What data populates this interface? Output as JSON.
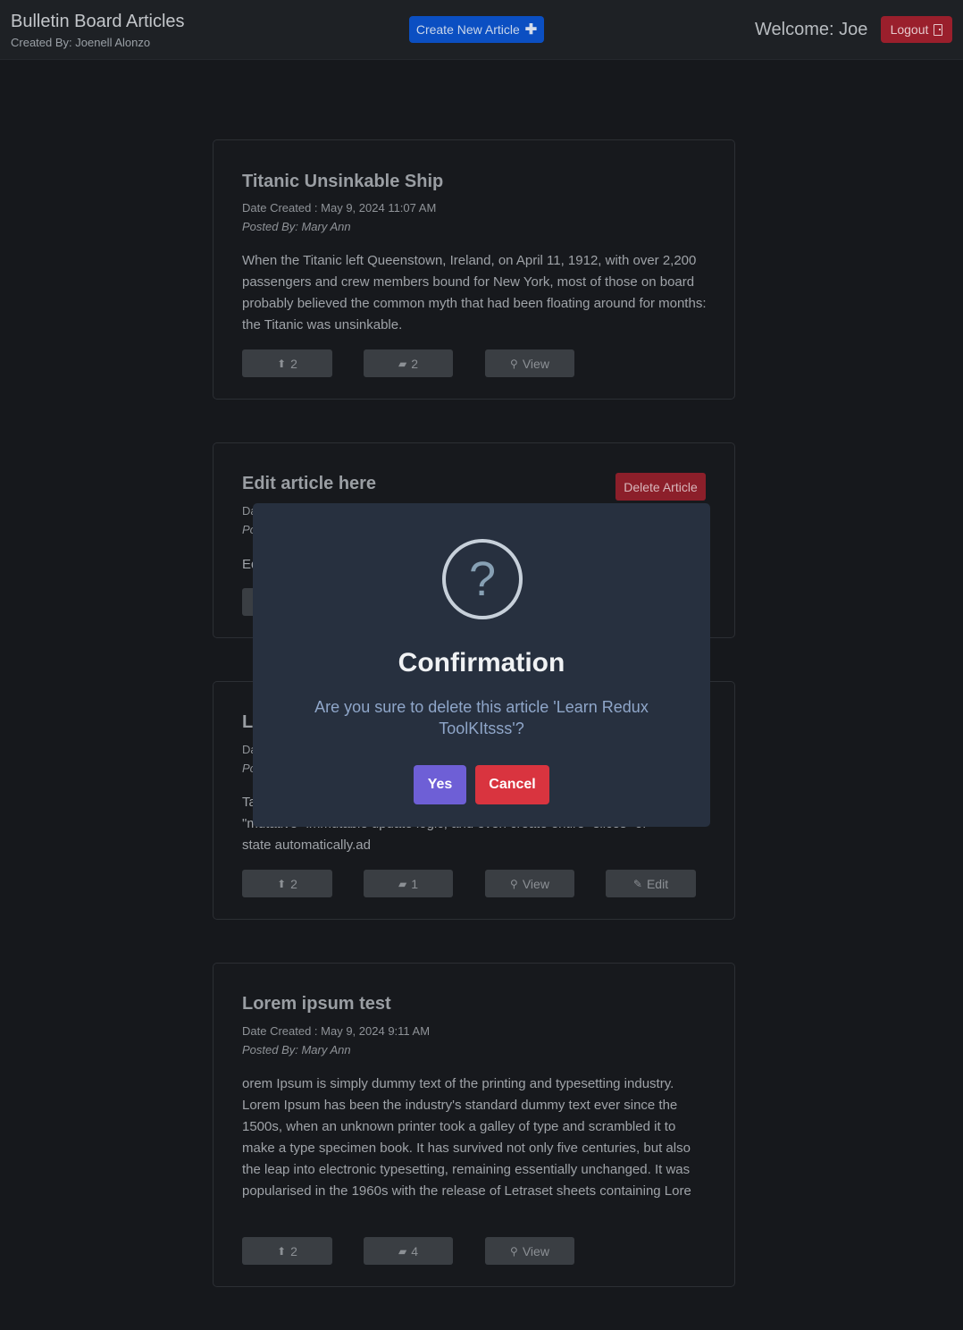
{
  "header": {
    "title": "Bulletin Board Articles",
    "subtitle": "Created By: Joenell Alonzo",
    "create_label": "Create New Article",
    "create_icon": "plus-icon",
    "welcome": "Welcome: Joe",
    "logout_label": "Logout",
    "logout_icon": "door-icon"
  },
  "articles": [
    {
      "title": "Titanic Unsinkable Ship",
      "date": "Date Created : May 9, 2024 11:07 AM",
      "posted": "Posted By: Mary Ann",
      "body": "When the Titanic left Queenstown, Ireland, on April 11, 1912, with over 2,200 passengers and crew members bound for New York, most of those on board probably believed the common myth that had been floating around for months: the Titanic was unsinkable.",
      "upvotes": "2",
      "comments": "2",
      "view_label": "View"
    },
    {
      "title": "Edit article here",
      "date_prefix": "Da",
      "posted_prefix": "Po",
      "body_prefix": "Ed",
      "delete_label": "Delete Article"
    },
    {
      "title_prefix": "Le",
      "date_prefix": "Da",
      "posted_prefix": "Po",
      "body_line1_prefix": "Ta",
      "body_line2": "\"mutative\" immutable update logic, and even create entire \"slices\" of",
      "body_line3": "state automatically.ad",
      "upvotes": "2",
      "comments": "1",
      "view_label": "View",
      "edit_label": "Edit"
    },
    {
      "title": "Lorem ipsum test",
      "date": "Date Created : May 9, 2024 9:11 AM",
      "posted": "Posted By: Mary Ann",
      "body": "orem Ipsum is simply dummy text of the printing and typesetting industry. Lorem Ipsum has been the industry's standard dummy text ever since the 1500s, when an unknown printer took a galley of type and scrambled it to make a type specimen book. It has survived not only five centuries, but also the leap into electronic typesetting, remaining essentially unchanged. It was popularised in the 1960s with the release of Letraset sheets containing Lore",
      "upvotes": "2",
      "comments": "4",
      "view_label": "View"
    }
  ],
  "modal": {
    "icon": "question-icon",
    "icon_glyph": "?",
    "title": "Confirmation",
    "message": "Are you sure to delete this article 'Learn Redux ToolKItsss'?",
    "yes_label": "Yes",
    "cancel_label": "Cancel"
  },
  "colors": {
    "background": "#16181c",
    "modal": "#27303f",
    "yes": "#6e5fd6",
    "cancel": "#d9343f",
    "create": "#0b4fc2",
    "logout": "#9a1f2c"
  }
}
